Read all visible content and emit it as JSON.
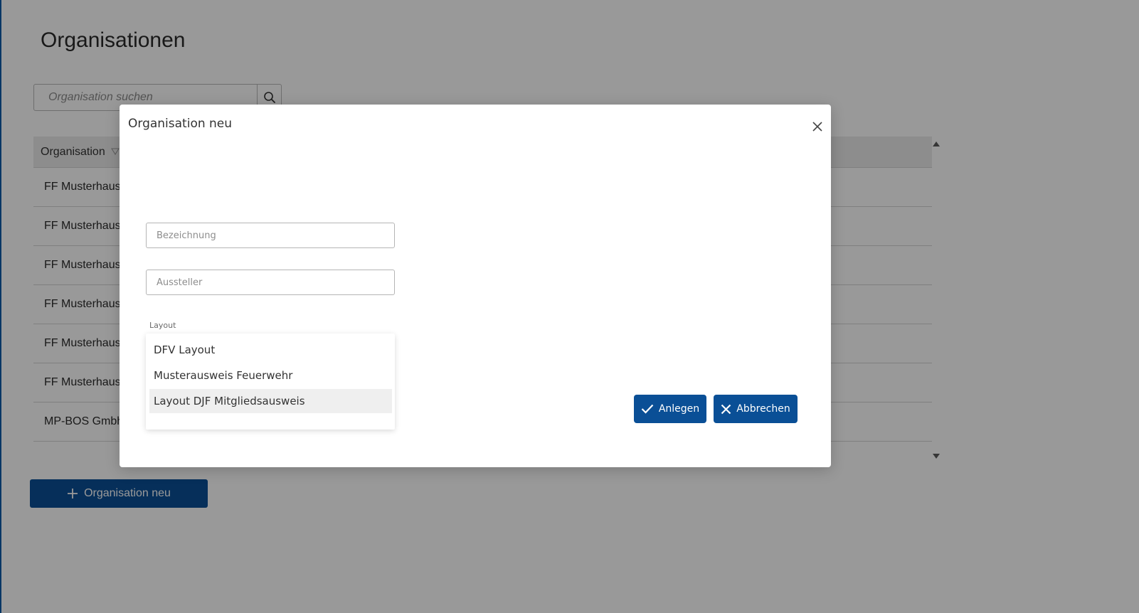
{
  "page": {
    "title": "Organisationen",
    "search_placeholder": "Organisation suchen",
    "new_button_label": "Organisation neu"
  },
  "table": {
    "column_header": "Organisation",
    "rows": [
      "FF Musterhaus",
      "FF Musterhaus",
      "FF Musterhaus",
      "FF Musterhaus",
      "FF Musterhaus",
      "FF Musterhaus",
      "MP-BOS Gmbh"
    ]
  },
  "dialog": {
    "title": "Organisation neu",
    "fields": {
      "bezeichnung_placeholder": "Bezeichnung",
      "aussteller_placeholder": "Aussteller",
      "layout_label": "Layout"
    },
    "layout_options": [
      "DFV Layout",
      "Musterausweis Feuerwehr",
      "Layout DJF Mitgliedsausweis"
    ],
    "highlighted_option": "Layout DJF Mitgliedsausweis",
    "create_label": "Anlegen",
    "cancel_label": "Abbrechen"
  },
  "colors": {
    "primary": "#0a4f96",
    "overlay": "rgba(0,0,0,0.4)"
  },
  "icons": [
    "search-icon",
    "sort-icon",
    "plus-icon",
    "close-icon",
    "check-icon",
    "cancel-x-icon"
  ]
}
